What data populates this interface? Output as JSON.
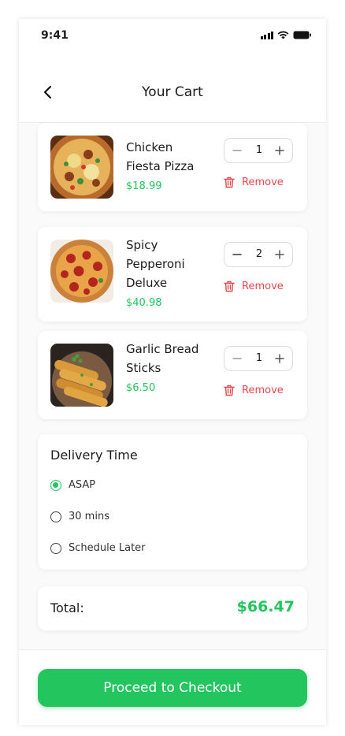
{
  "status_bar": {
    "time": "9:41",
    "icons": [
      "signal-icon",
      "wifi-icon",
      "battery-icon"
    ]
  },
  "header": {
    "title": "Your Cart",
    "back_icon": "chevron-left-icon"
  },
  "cart": {
    "remove_label": "Remove",
    "items": [
      {
        "name": "Chicken Fiesta Pizza",
        "price": "$18.99",
        "quantity": "1"
      },
      {
        "name": "Spicy Pepperoni Deluxe",
        "price": "$40.98",
        "quantity": "2"
      },
      {
        "name": "Garlic Bread Sticks",
        "price": "$6.50",
        "quantity": "1"
      }
    ]
  },
  "delivery": {
    "title": "Delivery Time",
    "options": [
      {
        "label": "ASAP",
        "selected": true
      },
      {
        "label": "30 mins",
        "selected": false
      },
      {
        "label": "Schedule Later",
        "selected": false
      }
    ]
  },
  "total": {
    "label": "Total:",
    "value": "$66.47"
  },
  "checkout": {
    "label": "Proceed to Checkout"
  },
  "colors": {
    "accent": "#22c55e",
    "danger": "#e5484d"
  }
}
